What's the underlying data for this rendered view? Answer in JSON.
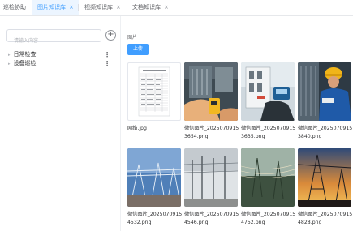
{
  "tabs": [
    {
      "label": "巡检协助",
      "active": false,
      "closable": false
    },
    {
      "label": "图片知识库",
      "active": true,
      "closable": true
    },
    {
      "label": "视频知识库",
      "active": false,
      "closable": true
    },
    {
      "label": "文档知识库",
      "active": false,
      "closable": true
    }
  ],
  "close_glyph": "×",
  "sidebar": {
    "search_placeholder": "请输入内容",
    "add_icon": "plus-circle-icon",
    "items": [
      {
        "label": "日常检查"
      },
      {
        "label": "设备巡检"
      }
    ],
    "more_glyph": "⋮"
  },
  "main": {
    "section_title": "图片",
    "upload_label": "上传",
    "files": [
      {
        "name_line1": "网络.jpg",
        "name_line2": ""
      },
      {
        "name_line1": "微信图片_2025070915",
        "name_line2": "3654.png"
      },
      {
        "name_line1": "微信图片_2025070915",
        "name_line2": "3635.png"
      },
      {
        "name_line1": "微信图片_2025070915",
        "name_line2": "3840.png"
      },
      {
        "name_line1": "微信图片_2025070915",
        "name_line2": "4532.png"
      },
      {
        "name_line1": "微信图片_2025070915",
        "name_line2": "4546.png"
      },
      {
        "name_line1": "微信图片_2025070915",
        "name_line2": "4752.png"
      },
      {
        "name_line1": "微信图片_2025070915",
        "name_line2": "4828.png"
      }
    ]
  },
  "colors": {
    "accent": "#409eff",
    "active_tab_bg": "#ecf5ff"
  }
}
